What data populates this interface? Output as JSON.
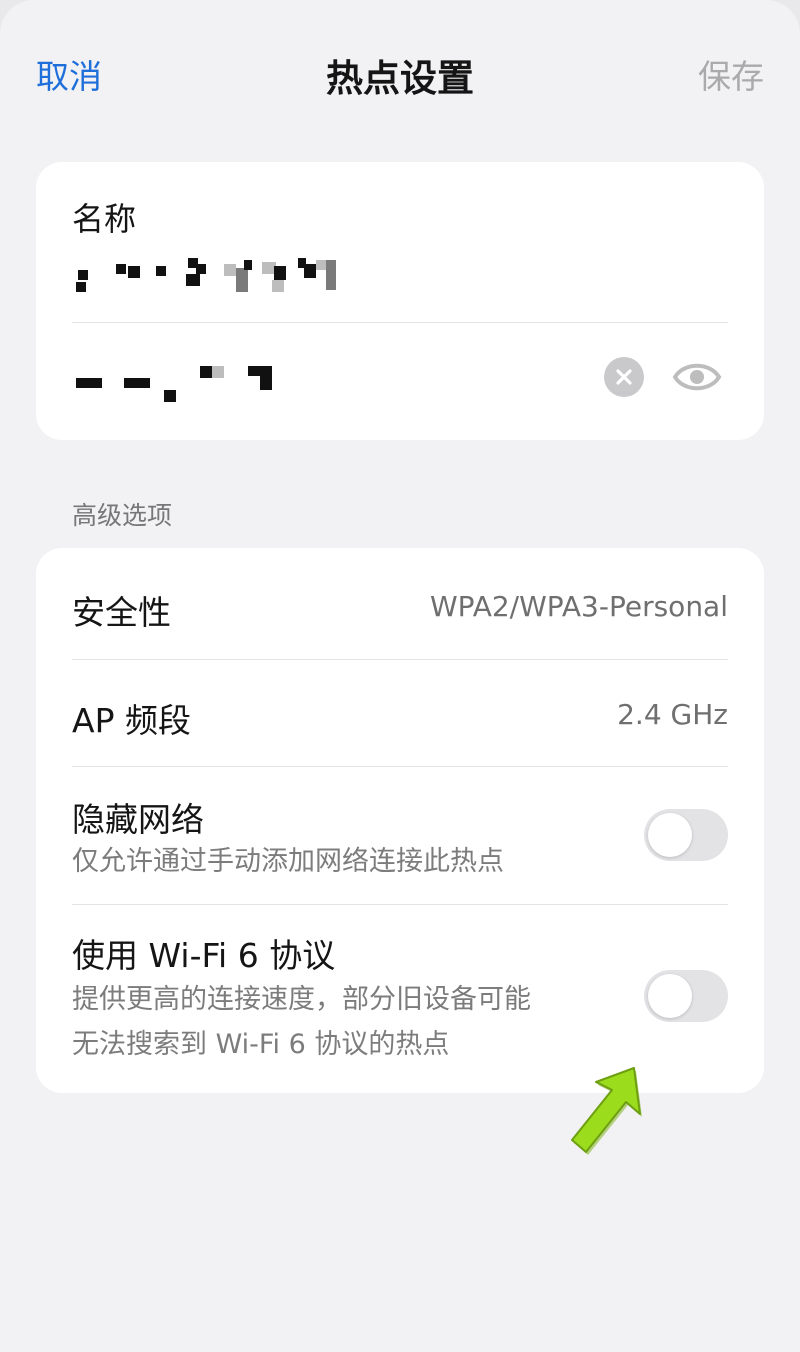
{
  "nav": {
    "cancel_label": "取消",
    "title": "热点设置",
    "save_label": "保存"
  },
  "hotspot": {
    "name_label": "名称",
    "name_value_redacted": true,
    "password_value_redacted": true,
    "clear_icon": "clear-icon",
    "visibility_icon": "eye-icon"
  },
  "advanced": {
    "header": "高级选项",
    "security": {
      "label": "安全性",
      "value": "WPA2/WPA3-Personal"
    },
    "ap_band": {
      "label": "AP 频段",
      "value": "2.4 GHz"
    },
    "hide_network": {
      "label": "隐藏网络",
      "description": "仅允许通过手动添加网络连接此热点",
      "enabled": false
    },
    "wifi6": {
      "label": "使用 Wi-Fi 6 协议",
      "description_line1": "提供更高的连接速度，部分旧设备可能",
      "description_line2": "无法搜索到 Wi-Fi 6 协议的热点",
      "enabled": false
    }
  },
  "colors": {
    "accent": "#1e6fd9",
    "disabled": "#aaaaaa",
    "annotation_arrow": "#9bdc1c"
  }
}
